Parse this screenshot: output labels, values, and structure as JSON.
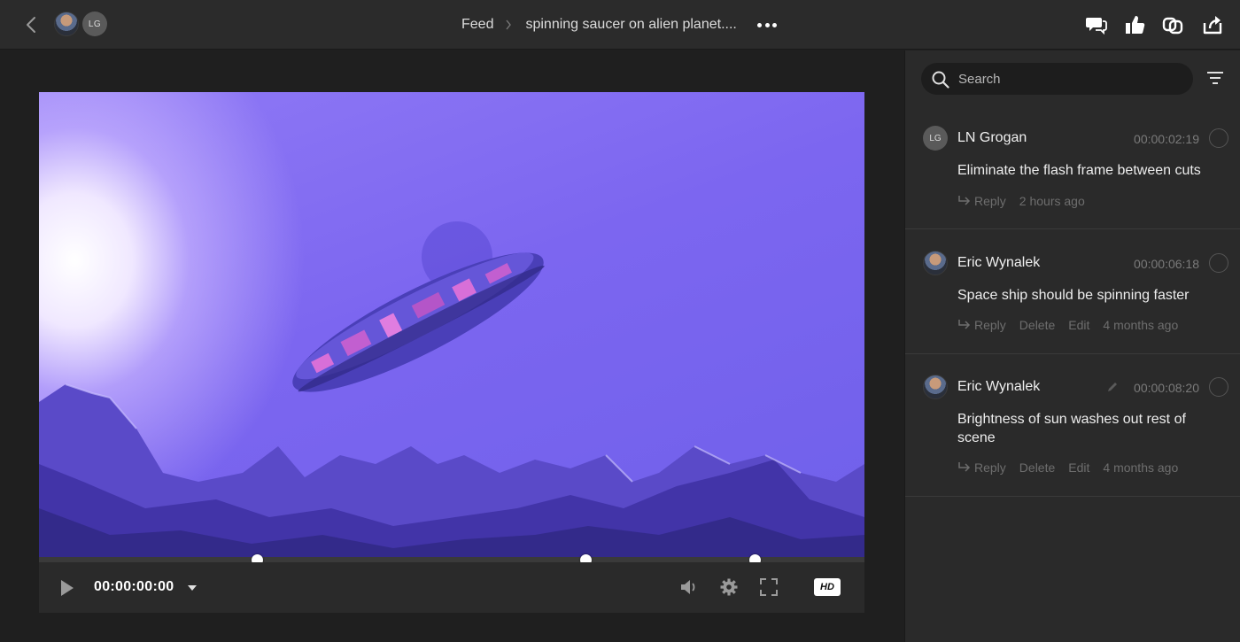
{
  "topbar": {
    "avatar_initials": "LG",
    "breadcrumb_root": "Feed",
    "breadcrumb_current": "spinning saucer on alien planet...."
  },
  "player": {
    "timecode": "00:00:00:00",
    "quality": "HD",
    "playhead_fraction": 0.0,
    "comment_marker_fractions": [
      0.265,
      0.663,
      0.868
    ]
  },
  "sidebar": {
    "search_placeholder": "Search",
    "comments": [
      {
        "author": "LN Grogan",
        "avatar": "LG",
        "timecode": "00:00:02:19",
        "text": "Eliminate the flash frame between cuts",
        "actions": [
          "Reply"
        ],
        "ago": "2 hours ago",
        "edited": false
      },
      {
        "author": "Eric Wynalek",
        "avatar": "photo",
        "timecode": "00:00:06:18",
        "text": "Space ship should be spinning faster",
        "actions": [
          "Reply",
          "Delete",
          "Edit"
        ],
        "ago": "4 months ago",
        "edited": false
      },
      {
        "author": "Eric Wynalek",
        "avatar": "photo",
        "timecode": "00:00:08:20",
        "text": "Brightness of sun washes out rest of scene",
        "actions": [
          "Reply",
          "Delete",
          "Edit"
        ],
        "ago": "4 months ago",
        "edited": true
      }
    ]
  },
  "icons": {
    "back": "chevron-left-icon",
    "comments": "speech-bubbles-icon",
    "approve": "thumbs-up-icon",
    "versions": "link-versions-icon",
    "share": "share-icon",
    "volume": "volume-icon",
    "settings": "gear-icon",
    "fullscreen": "fullscreen-icon",
    "filter": "filter-icon"
  },
  "colors": {
    "topbar_bg": "#2b2b2b",
    "sidebar_bg": "#2a2a2a",
    "video_tint": "#7c66f0"
  }
}
